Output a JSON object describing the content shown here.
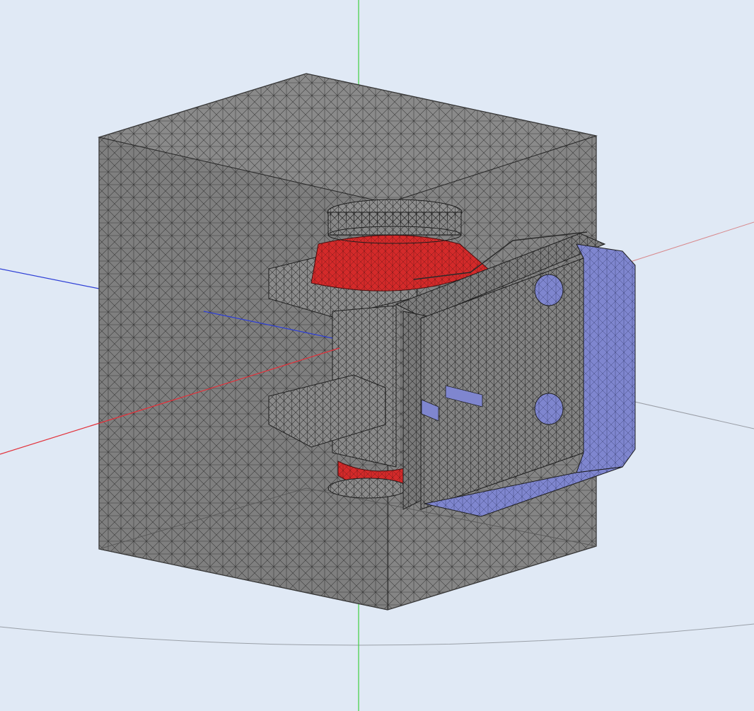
{
  "viewport": {
    "background_color": "#e0e9f5",
    "mesh_color": "#808080",
    "mesh_line_color": "#1c1c1c",
    "wire_color": "#2a2a2a",
    "red_region_color": "#d42a2a",
    "blue_region_color": "#7f86cf",
    "axis_x_color": "#e2313a",
    "axis_y_color": "#3fcf3f",
    "axis_z_color": "#2e3fd6",
    "axis_secondary_color": "#9a9ea6"
  },
  "scene": {
    "object": "tetrahedral-mesh",
    "parts": [
      "bounding-box-mesh",
      "mount-bracket-mesh",
      "rubber-bushing-upper",
      "rubber-bushing-lower",
      "mounting-plate"
    ]
  }
}
